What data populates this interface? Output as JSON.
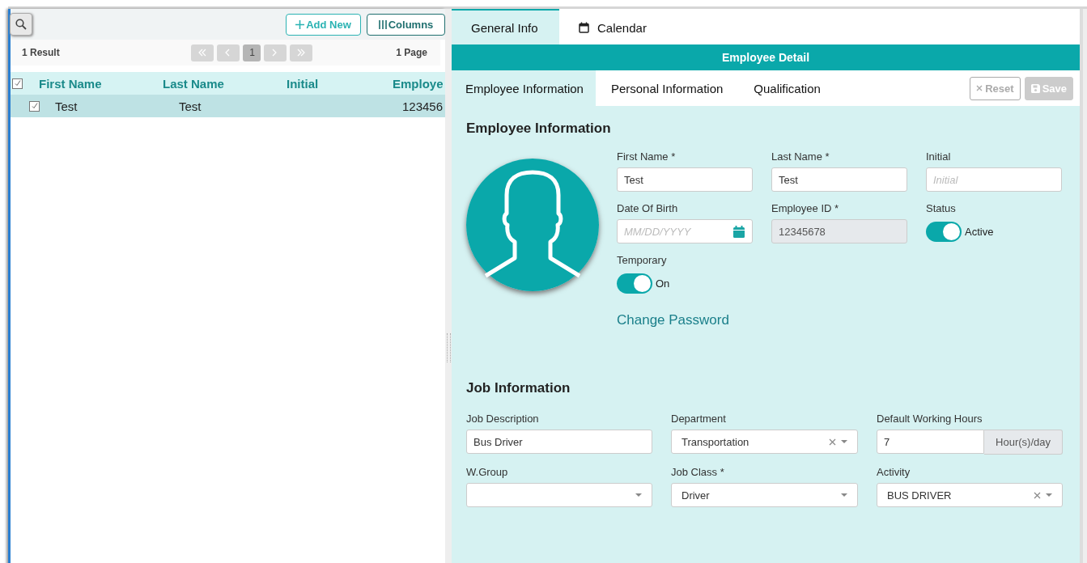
{
  "list_panel": {
    "add_button": "Add New",
    "columns_button": "Columns",
    "result_count": "1 Result",
    "pager": [
      {
        "kind": "first",
        "disabled": true
      },
      {
        "kind": "prev",
        "disabled": true
      },
      {
        "kind": "page",
        "label": "1",
        "selected": true
      },
      {
        "kind": "next",
        "disabled": true
      },
      {
        "kind": "last",
        "disabled": true
      }
    ],
    "page_count": "1 Page",
    "table": {
      "header_checked": true,
      "columns": [
        "First Name",
        "Last Name",
        "Initial",
        "Employe"
      ],
      "rows": [
        {
          "checked": true,
          "selected": true,
          "first_name": "Test",
          "last_name": "Test",
          "column_4": "123456"
        }
      ]
    }
  },
  "tabs": [
    {
      "label": "General Info",
      "selected": true
    },
    {
      "label": "Calendar",
      "selected": false,
      "kind": "calendar"
    }
  ],
  "panel_title": "Employee Detail",
  "subtabs": [
    {
      "label": "Employee Information",
      "selected": true
    },
    {
      "label": "Personal Information",
      "selected": false
    },
    {
      "label": "Qualification",
      "selected": false
    }
  ],
  "actions": [
    {
      "kind": "reset",
      "label": "Reset",
      "disabled": true
    },
    {
      "kind": "save",
      "label": "Save",
      "disabled": true
    }
  ],
  "employee_section": {
    "title": "Employee Information",
    "fields": [
      {
        "kind": "text",
        "label": "First Name *",
        "value": "Test"
      },
      {
        "kind": "text",
        "label": "Last Name *",
        "value": "Test"
      },
      {
        "kind": "text",
        "label": "Initial",
        "placeholder": "Initial"
      },
      {
        "kind": "date",
        "label": "Date Of Birth",
        "placeholder": "MM/DD/YYYY"
      },
      {
        "kind": "text",
        "label": "Employee ID *",
        "value": "12345678",
        "disabled": true
      },
      {
        "kind": "toggle",
        "label": "Status",
        "on": true,
        "text": "Active"
      },
      {
        "kind": "toggle",
        "label": "Temporary",
        "on": true,
        "text": "On"
      }
    ],
    "link": "Change Password"
  },
  "job_section": {
    "title": "Job Information",
    "fields": [
      {
        "kind": "text",
        "label": "Job Description",
        "value": "Bus Driver"
      },
      {
        "kind": "select",
        "label": "Department",
        "value": "Transportation",
        "clearable": true
      },
      {
        "kind": "addon",
        "label": "Default Working Hours",
        "value": "7",
        "addon": "Hour(s)/day"
      },
      {
        "kind": "select",
        "label": "W.Group",
        "clearable": false
      },
      {
        "kind": "select",
        "label": "Job Class *",
        "value": "Driver",
        "clearable": false
      },
      {
        "kind": "select",
        "label": "Activity",
        "value": "BUS DRIVER",
        "clearable": true
      }
    ]
  }
}
